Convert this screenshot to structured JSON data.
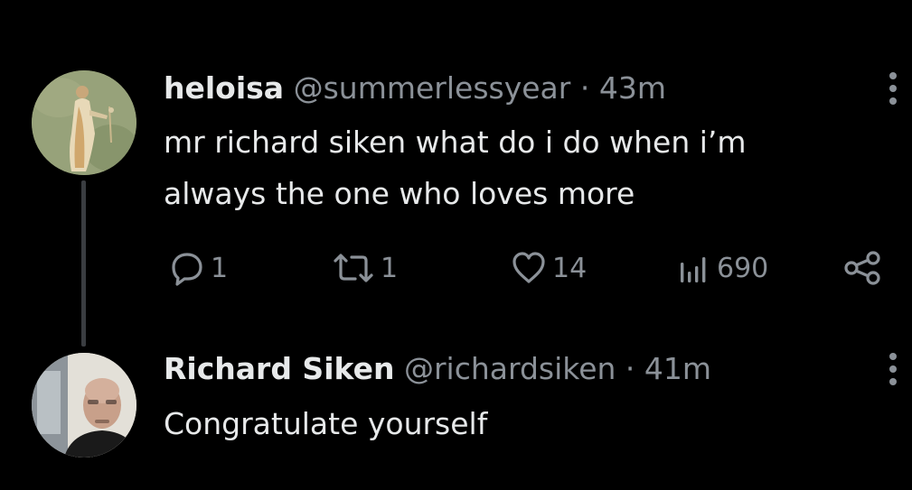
{
  "tweets": [
    {
      "name": "heloisa",
      "handle": "@summerlessyear",
      "separator": "·",
      "time": "43m",
      "text_lines": [
        "mr richard siken what do i do when i’m",
        "always the one who loves more"
      ],
      "actions": {
        "replies": "1",
        "reposts": "1",
        "likes": "14",
        "views": "690"
      }
    },
    {
      "name": "Richard Siken",
      "handle": "@richardsiken",
      "separator": "·",
      "time": "41m",
      "text_lines": [
        "Congratulate yourself"
      ]
    }
  ],
  "icons": {
    "reply": "reply-icon",
    "repost": "repost-icon",
    "like": "heart-icon",
    "views": "views-icon",
    "share": "share-icon",
    "more": "more-dots-icon"
  },
  "colors": {
    "background": "#000000",
    "text_primary": "#e7e9ea",
    "text_secondary": "#8b9198",
    "thread_line": "#3a3d41"
  }
}
